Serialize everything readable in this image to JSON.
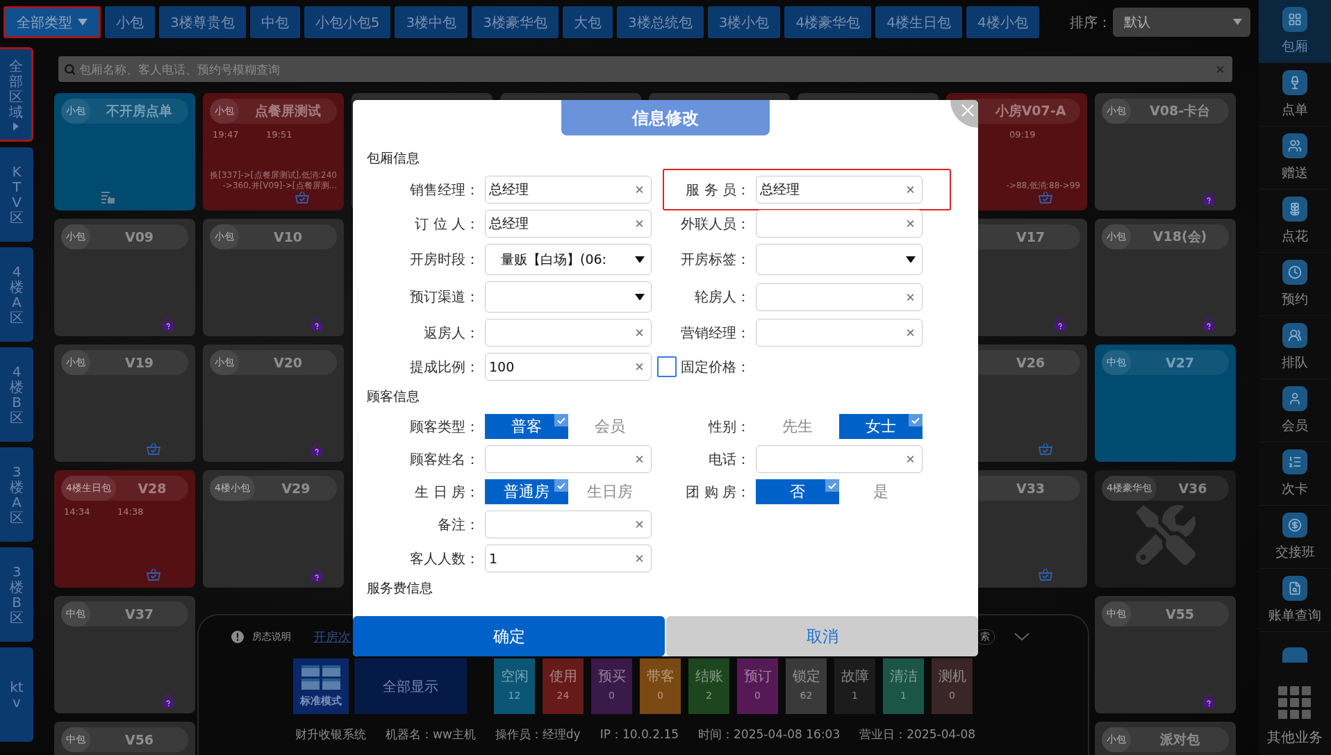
{
  "type_tabs": [
    {
      "label": "全部类型",
      "kind": "dropdown",
      "selected": true
    },
    {
      "label": "小包",
      "kind": "tab",
      "selected": false
    },
    {
      "label": "3楼尊贵包",
      "kind": "tab",
      "selected": false
    },
    {
      "label": "中包",
      "kind": "tab",
      "selected": false
    },
    {
      "label": "小包小包5",
      "kind": "tab",
      "selected": false
    },
    {
      "label": "3楼中包",
      "kind": "tab",
      "selected": false
    },
    {
      "label": "3楼豪华包",
      "kind": "tab",
      "selected": false
    },
    {
      "label": "大包",
      "kind": "tab",
      "selected": false
    },
    {
      "label": "3楼总统包",
      "kind": "tab",
      "selected": false
    },
    {
      "label": "3楼小包",
      "kind": "tab",
      "selected": false
    },
    {
      "label": "4楼豪华包",
      "kind": "tab",
      "selected": false
    },
    {
      "label": "4楼生日包",
      "kind": "tab",
      "selected": false
    },
    {
      "label": "4楼小包",
      "kind": "tab",
      "selected": false
    }
  ],
  "sort": {
    "label": "排序：",
    "value": "默认"
  },
  "area_tabs": [
    {
      "label": "全部区域",
      "kind": "expand",
      "selected": true
    },
    {
      "label": "KTV区",
      "kind": "tab",
      "selected": false
    },
    {
      "label": "4楼A区",
      "kind": "tab",
      "selected": false
    },
    {
      "label": "4楼B区",
      "kind": "tab",
      "selected": false
    },
    {
      "label": "3楼A区",
      "kind": "tab",
      "selected": false
    },
    {
      "label": "3楼B区",
      "kind": "tab",
      "selected": false
    },
    {
      "label": "ktv",
      "kind": "tab",
      "selected": false
    }
  ],
  "search": {
    "placeholder": "包厢名称、客人电话、预约号模糊查询"
  },
  "rooms": [
    {
      "kind": "notes",
      "color": "#014a70",
      "tag": "小包",
      "title": "不开房点单"
    },
    {
      "kind": "basket",
      "color": "#551014",
      "tag": "小包",
      "title": "点餐屏测试",
      "start": "19:47",
      "end": "19:51",
      "note": "换[337]->[点餐屏测试],低消:240->360,并[V09]->[点餐屏测..."
    },
    {
      "kind": "partial",
      "color": "#2d2d2d"
    },
    {
      "kind": "partial",
      "color": "#2d2d2d"
    },
    {
      "kind": "partial",
      "color": "#2d2d2d"
    },
    {
      "kind": "partial",
      "color": "#2d2d2d"
    },
    {
      "kind": "basket",
      "color": "#551014",
      "title": "小房V07-A",
      "end": "09:19",
      "note": "->88,低消:88->99"
    },
    {
      "kind": "padlock",
      "color": "#2d2d2d",
      "tag": "小包",
      "title": "V08-卡台"
    },
    {
      "kind": "padlock",
      "color": "#2d2d2d",
      "tag": "小包",
      "title": "V09"
    },
    {
      "kind": "padlock",
      "color": "#2d2d2d",
      "tag": "小包",
      "title": "V10"
    },
    {
      "kind": "hidden"
    },
    {
      "kind": "hidden"
    },
    {
      "kind": "hidden"
    },
    {
      "kind": "hidden"
    },
    {
      "kind": "padlock",
      "color": "#2d2d2d",
      "title": "V17"
    },
    {
      "kind": "padlock",
      "color": "#2d2d2d",
      "tag": "小包",
      "title": "V18(会)"
    },
    {
      "kind": "basket",
      "color": "#2d2d2d",
      "tag": "小包",
      "title": "V19"
    },
    {
      "kind": "padlock",
      "color": "#2d2d2d",
      "tag": "小包",
      "title": "V20"
    },
    {
      "kind": "hidden"
    },
    {
      "kind": "hidden"
    },
    {
      "kind": "hidden"
    },
    {
      "kind": "hidden"
    },
    {
      "kind": "basket",
      "color": "#2d2d2d",
      "title": "V26"
    },
    {
      "kind": "plain",
      "color": "#014a70",
      "tag": "中包",
      "title": "V27"
    },
    {
      "kind": "basket",
      "color": "#551014",
      "tag": "4楼生日包",
      "title": "V28",
      "start": "14:34",
      "end": "14:38"
    },
    {
      "kind": "padlock",
      "color": "#2d2d2d",
      "tag": "4楼小包",
      "title": "V29"
    },
    {
      "kind": "hidden"
    },
    {
      "kind": "hidden"
    },
    {
      "kind": "hidden"
    },
    {
      "kind": "hidden"
    },
    {
      "kind": "basket",
      "color": "#2d2d2d",
      "title": "V33"
    },
    {
      "kind": "repair",
      "color": "#1b1b1b",
      "tag": "4楼豪华包",
      "title": "V36"
    },
    {
      "kind": "padlock",
      "color": "#2d2d2d",
      "tag": "中包",
      "title": "V37"
    },
    {
      "kind": "hidden"
    },
    {
      "kind": "hidden"
    },
    {
      "kind": "hidden"
    },
    {
      "kind": "hidden"
    },
    {
      "kind": "hidden"
    },
    {
      "kind": "hidden"
    },
    {
      "kind": "padlock",
      "color": "#2d2d2d",
      "tag": "中包",
      "title": "V55"
    },
    {
      "kind": "plain",
      "color": "#2d2d2d",
      "tag": "中包",
      "title": "V56"
    },
    {
      "kind": "hidden"
    },
    {
      "kind": "hidden"
    },
    {
      "kind": "hidden"
    },
    {
      "kind": "hidden"
    },
    {
      "kind": "hidden"
    },
    {
      "kind": "hidden"
    },
    {
      "kind": "plain",
      "color": "#2d2d2d",
      "tag": "小包",
      "title": "派对包"
    }
  ],
  "legend": {
    "info": "房态说明",
    "link": "开房次",
    "search": "索",
    "mode": "标准模式",
    "show_all": "全部显示",
    "statuses": [
      {
        "label": "空闲",
        "count": "12",
        "color": "#0b5674"
      },
      {
        "label": "使用",
        "count": "24",
        "color": "#661a1a"
      },
      {
        "label": "预买",
        "count": "0",
        "color": "#3a1a48"
      },
      {
        "label": "带客",
        "count": "0",
        "color": "#7a4812"
      },
      {
        "label": "结账",
        "count": "2",
        "color": "#1d461f"
      },
      {
        "label": "预订",
        "count": "0",
        "color": "#551a55"
      },
      {
        "label": "锁定",
        "count": "62",
        "color": "#3a3a3a"
      },
      {
        "label": "故障",
        "count": "1",
        "color": "#1c1c1c"
      },
      {
        "label": "清洁",
        "count": "1",
        "color": "#1a5546"
      },
      {
        "label": "测机",
        "count": "0",
        "color": "#3a2626"
      }
    ]
  },
  "status_bar": [
    "财升收银系统",
    "机器名：ww主机",
    "操作员：经理dy",
    "IP：10.0.2.15",
    "时间：2025-04-08 16:03",
    "营业日：2025-04-08"
  ],
  "sidebar": {
    "items": [
      {
        "label": "包厢",
        "selected": true
      },
      {
        "label": "点单",
        "selected": false
      },
      {
        "label": "赠送",
        "selected": false
      },
      {
        "label": "点花",
        "selected": false
      },
      {
        "label": "预约",
        "selected": false
      },
      {
        "label": "排队",
        "selected": false
      },
      {
        "label": "会员",
        "selected": false
      },
      {
        "label": "次卡",
        "selected": false
      },
      {
        "label": "交接班",
        "selected": false
      },
      {
        "label": "账单查询",
        "selected": false
      }
    ],
    "more": "其他业务"
  },
  "dialog": {
    "title": "信息修改",
    "sections": [
      {
        "title": "包厢信息",
        "rows": [
          [
            {
              "label": "销售经理：",
              "kind": "input",
              "value": "总经理",
              "highlighted": false
            },
            {
              "label": "服 务 员：",
              "kind": "input",
              "value": "总经理",
              "highlighted": true
            }
          ],
          [
            {
              "label": "订 位 人：",
              "kind": "input",
              "value": "总经理",
              "highlighted": false
            },
            {
              "label": "外联人员：",
              "kind": "input",
              "highlighted": false
            }
          ],
          [
            {
              "label": "开房时段：",
              "kind": "select",
              "value": "量贩【白场】(06:",
              "highlighted": false
            },
            {
              "label": "开房标签：",
              "kind": "select",
              "highlighted": false
            }
          ],
          [
            {
              "label": "预订渠道：",
              "kind": "select",
              "highlighted": false
            },
            {
              "label": "轮房人：",
              "kind": "input",
              "highlighted": false
            }
          ],
          [
            {
              "label": "返房人：",
              "kind": "input",
              "highlighted": false
            },
            {
              "label": "营销经理：",
              "kind": "input",
              "highlighted": false
            }
          ],
          [
            {
              "label": "提成比例：",
              "kind": "input",
              "value": "100",
              "highlighted": false
            },
            {
              "label": "固定价格：",
              "kind": "checkbox",
              "checked": false,
              "highlighted": false
            }
          ]
        ]
      },
      {
        "title": "顾客信息",
        "rows": [
          [
            {
              "label": "顾客类型：",
              "kind": "choice",
              "highlighted": false,
              "options": [
                {
                  "label": "普客",
                  "selected": true
                },
                {
                  "label": "会员",
                  "selected": false
                }
              ]
            },
            {
              "label": "性别：",
              "kind": "choice",
              "highlighted": false,
              "options": [
                {
                  "label": "先生",
                  "selected": false
                },
                {
                  "label": "女士",
                  "selected": true
                }
              ]
            }
          ],
          [
            {
              "label": "顾客姓名：",
              "kind": "input",
              "highlighted": false
            },
            {
              "label": "电话：",
              "kind": "input",
              "highlighted": false
            }
          ],
          [
            {
              "label": "生 日 房：",
              "kind": "choice",
              "highlighted": false,
              "options": [
                {
                  "label": "普通房",
                  "selected": true
                },
                {
                  "label": "生日房",
                  "selected": false
                }
              ]
            },
            {
              "label": "团 购 房：",
              "kind": "choice",
              "highlighted": false,
              "options": [
                {
                  "label": "否",
                  "selected": true
                },
                {
                  "label": "是",
                  "selected": false
                }
              ]
            }
          ],
          [
            {
              "label": "备注：",
              "kind": "input",
              "highlighted": false
            }
          ],
          [
            {
              "label": "客人人数：",
              "kind": "input",
              "value": "1",
              "highlighted": false
            }
          ]
        ]
      },
      {
        "title": "服务费信息"
      }
    ],
    "confirm": "确定",
    "cancel": "取消"
  }
}
